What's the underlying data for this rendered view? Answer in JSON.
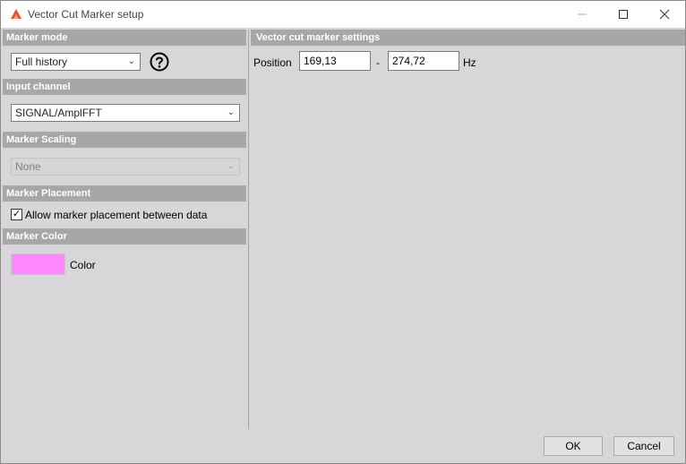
{
  "window": {
    "title": "Vector Cut Marker setup",
    "app_icon": "dewesoft-logo-icon",
    "controls": [
      "minimize-icon",
      "maximize-icon",
      "close-icon"
    ]
  },
  "left_panel": {
    "marker_mode": {
      "header": "Marker mode",
      "selected": "Full history",
      "help_icon": "help-circle-icon"
    },
    "input_channel": {
      "header": "Input channel",
      "selected": "SIGNAL/AmplFFT"
    },
    "marker_scaling": {
      "header": "Marker Scaling",
      "selected": "None",
      "disabled": true
    },
    "marker_placement": {
      "header": "Marker Placement",
      "checkbox_label": "Allow marker placement between data",
      "checked": true,
      "check_glyph": "✓"
    },
    "marker_color": {
      "header": "Marker Color",
      "label": "Color",
      "color": "#ff88ff"
    }
  },
  "right_panel": {
    "header": "Vector cut marker settings",
    "position_label": "Position",
    "from_value": "169,13",
    "separator": "-",
    "to_value": "274,72",
    "unit": "Hz"
  },
  "footer": {
    "ok_label": "OK",
    "cancel_label": "Cancel"
  },
  "theme": {
    "header_bg": "#a7a7a7",
    "panel_bg": "#d8d6d9",
    "accent": "#e8532c"
  }
}
